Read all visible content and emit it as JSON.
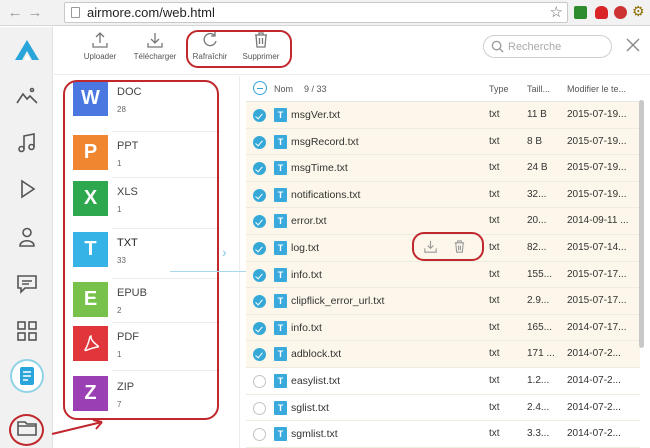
{
  "browser": {
    "url": "airmore.com/web.html"
  },
  "toolbar": {
    "upload_label": "Uploader",
    "download_label": "Télécharger",
    "refresh_label": "Rafraîchir",
    "delete_label": "Supprimer",
    "search_placeholder": "Recherche"
  },
  "categories": [
    {
      "letter": "W",
      "name": "DOC",
      "count": "28",
      "color": "#4a78e0"
    },
    {
      "letter": "P",
      "name": "PPT",
      "count": "1",
      "color": "#f0862f"
    },
    {
      "letter": "X",
      "name": "XLS",
      "count": "1",
      "color": "#2ea84e"
    },
    {
      "letter": "T",
      "name": "TXT",
      "count": "33",
      "color": "#35b3e6"
    },
    {
      "letter": "E",
      "name": "EPUB",
      "count": "2",
      "color": "#78c24c"
    },
    {
      "letter": "",
      "name": "PDF",
      "count": "1",
      "color": "#e0353a"
    },
    {
      "letter": "Z",
      "name": "ZIP",
      "count": "7",
      "color": "#9b3fb5"
    }
  ],
  "list_header": {
    "name": "Nom",
    "count": "9 / 33",
    "type": "Type",
    "size": "Taill...",
    "modified": "Modifier le te..."
  },
  "files": [
    {
      "name": "msgVer.txt",
      "type": "txt",
      "size": "11 B",
      "date": "2015-07-19...",
      "checked": true
    },
    {
      "name": "msgRecord.txt",
      "type": "txt",
      "size": "8 B",
      "date": "2015-07-19...",
      "checked": true
    },
    {
      "name": "msgTime.txt",
      "type": "txt",
      "size": "24 B",
      "date": "2015-07-19...",
      "checked": true
    },
    {
      "name": "notifications.txt",
      "type": "txt",
      "size": "32...",
      "date": "2015-07-19...",
      "checked": true
    },
    {
      "name": "error.txt",
      "type": "txt",
      "size": "20...",
      "date": "2014-09-11 ...",
      "checked": true
    },
    {
      "name": "log.txt",
      "type": "txt",
      "size": "82...",
      "date": "2015-07-14...",
      "checked": true
    },
    {
      "name": "info.txt",
      "type": "txt",
      "size": "155...",
      "date": "2015-07-17...",
      "checked": true
    },
    {
      "name": "clipflick_error_url.txt",
      "type": "txt",
      "size": "2.9...",
      "date": "2015-07-17...",
      "checked": true
    },
    {
      "name": "info.txt",
      "type": "txt",
      "size": "165...",
      "date": "2014-07-17...",
      "checked": true
    },
    {
      "name": "adblock.txt",
      "type": "txt",
      "size": "171 ...",
      "date": "2014-07-2...",
      "checked": true
    },
    {
      "name": "easylist.txt",
      "type": "txt",
      "size": "1.2...",
      "date": "2014-07-2...",
      "checked": false
    },
    {
      "name": "sglist.txt",
      "type": "txt",
      "size": "2.4...",
      "date": "2014-07-2...",
      "checked": false
    },
    {
      "name": "sgmlist.txt",
      "type": "txt",
      "size": "3.3...",
      "date": "2014-07-2...",
      "checked": false
    }
  ],
  "file_icon_letter": "T",
  "colors": {
    "accent": "#36a8d8",
    "annotation_red": "#c0282d",
    "selected_row": "#fcf7ea"
  }
}
